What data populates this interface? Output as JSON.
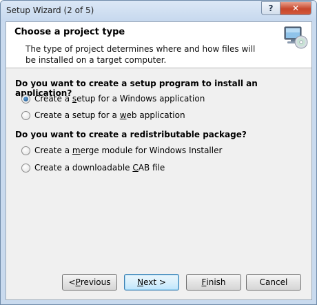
{
  "window": {
    "title": "Setup Wizard (2 of 5)",
    "help_label": "?",
    "close_label": "✕"
  },
  "header": {
    "title": "Choose a project type",
    "description": "The type of project determines where and how files will be installed on a target computer."
  },
  "group1": {
    "question": "Do you want to create a setup program to install an application?",
    "options": [
      {
        "pre": "Create a ",
        "mnemonic": "s",
        "post": "etup for a Windows application",
        "checked": true
      },
      {
        "pre": "Create a setup for a ",
        "mnemonic": "w",
        "post": "eb application",
        "checked": false
      }
    ]
  },
  "group2": {
    "question": "Do you want to create a redistributable package?",
    "options": [
      {
        "pre": "Create a ",
        "mnemonic": "m",
        "post": "erge module for Windows Installer",
        "checked": false
      },
      {
        "pre": "Create a downloadable ",
        "mnemonic": "C",
        "post": "AB file",
        "checked": false
      }
    ]
  },
  "buttons": {
    "previous": {
      "pre": "< ",
      "mnemonic": "P",
      "post": "revious"
    },
    "next": {
      "pre": "",
      "mnemonic": "N",
      "post": "ext >"
    },
    "finish": {
      "pre": "",
      "mnemonic": "F",
      "post": "inish"
    },
    "cancel": {
      "pre": "Cancel",
      "mnemonic": "",
      "post": ""
    }
  },
  "colors": {
    "title_bar": "#c6d8ee",
    "close_button": "#c7472c",
    "default_button_border": "#3c7fb1"
  },
  "icons": {
    "header": "computer-cd-icon",
    "help": "help-icon",
    "close": "close-icon"
  }
}
